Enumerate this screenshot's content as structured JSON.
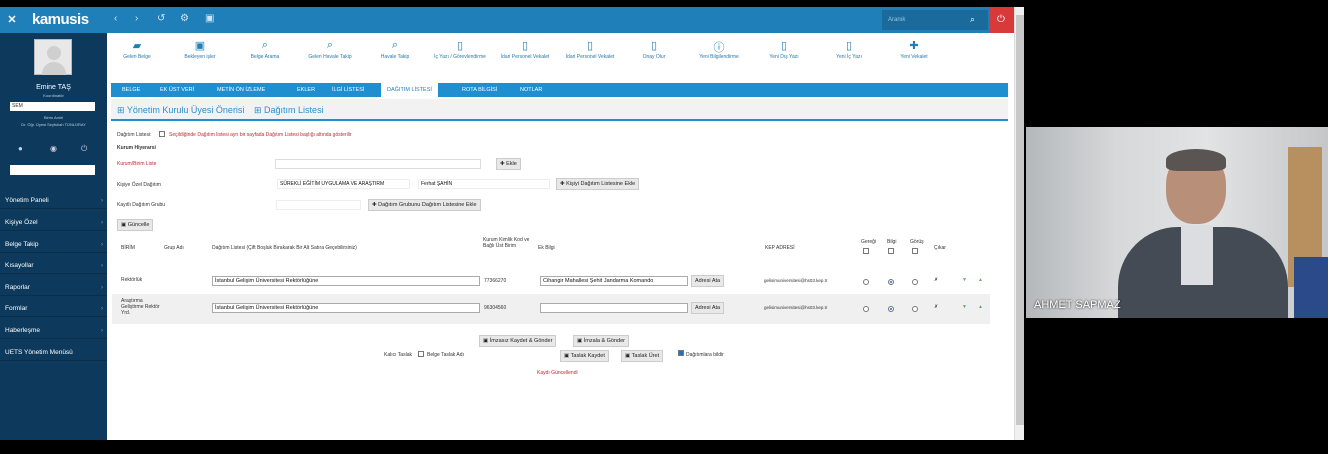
{
  "app": {
    "logo": "kamusis",
    "search_placeholder": "Aranık"
  },
  "sidebar": {
    "user_name": "Emine TAŞ",
    "user_role": "Koordinatör",
    "unit_select": "SEM",
    "info_line1": "Birim Amiri",
    "info_line2": "Dr. Öğr. Üyesi Seyfullah TÜNLÜRAY",
    "menu": [
      "Yönetim Paneli",
      "Kişiye Özel",
      "Belge Takip",
      "Kısayollar",
      "Raporlar",
      "Formlar",
      "Haberleşme",
      "UETS Yönetim Menüsü"
    ]
  },
  "toolbar": [
    "Gelen Belge",
    "Bekleyen işler",
    "Belge Arama",
    "Gelen Havale Takip",
    "Havale Takip",
    "İç Yazı / Görevlendirme",
    "İdari Personel Vekalet",
    "İdari Personel Vekalet",
    "Onay Olur",
    "Yeni Bilgilendirme",
    "Yeni Dış Yazı",
    "Yeni İç Yazı",
    "Yeni Vekalet"
  ],
  "tabs": [
    "BELGE",
    "EK ÜST VERİ",
    "METİN ÖN İZLEME",
    "EKLER",
    "İLGİ LİSTESİ",
    "DAĞITIM LİSTESİ",
    "ROTA BİLGİSİ",
    "NOTLAR"
  ],
  "breadcrumb": {
    "item1": "Yönetim Kurulu Üyesi Önerisi",
    "item2": "Dağıtım Listesi"
  },
  "form": {
    "dist_label": "Dağıtım Listesi:",
    "dist_note": "Seçildiğinde Dağıtım listesi ayrı bir sayfada Dağıtım Listesi başlığı altında gösterilir",
    "kurum_hiyerarsi": "Kurum Hiyerarsi",
    "kurum_birim_label": "Kurum/Birim Liste",
    "ekle": "Ekle",
    "kisiye_ozel_label": "Kişiye Özel Dağıtım",
    "kisiye_ozel_value": "SÜREKLİ EĞİTİM UYGULAMA VE ARAŞTIRM",
    "kisi_value": "Ferhat ŞAHİN",
    "kisiyi_ekle": "Kişiyi Dağıtım Listesine Ekle",
    "kayitli_label": "Kayıtlı Dağıtım Grubu",
    "grup_ekle": "Dağıtım Grubunu Dağıtım Listesine Ekle",
    "guncelle": "Güncelle"
  },
  "table": {
    "headers": {
      "birim": "BİRİM",
      "grup": "Grup Adı",
      "liste": "Dağıtım Listesi (Çift Boşluk Bırakarak Bir Alt Satıra Geçebilirsiniz)",
      "kurum_kod": "Kurum Kimlik Kod ve Bağlı Üst Birim",
      "ek": "Ek Bilgi",
      "kep": "KEP ADRESİ",
      "geregi": "Gereği",
      "bilgi": "Bilgi",
      "gorus": "Görüş",
      "cikar": "Çıkar"
    },
    "rows": [
      {
        "birim": "Rektörlük",
        "liste": "İstanbul Gelişim Üniversitesi Rektörlüğüne",
        "kod": "77366270",
        "ek": "Cihangir Mahallesi Şehit Jandarma Komando",
        "adres_btn": "Adresi Ata",
        "kep": "gelisimuniversitesi@hs03.kep.tr"
      },
      {
        "birim": "Araştırma Geliştirme Rektör Yrd.",
        "liste": "İstanbul Gelişim Üniversitesi Rektörlüğüne",
        "kod": "96304560",
        "ek": "",
        "adres_btn": "Adresi Ata",
        "kep": "gelisimuniversitesi@hs03.kep.tr"
      }
    ]
  },
  "actions": {
    "imzasiz": "İmzasız Kaydet & Gönder",
    "imzala": "İmzala & Gönder",
    "kalici_taslak": "Kalıcı Taslak",
    "taslak_adi": "Belge Taslak Adı",
    "taslak_kaydet": "Taslak Kaydet",
    "taslak_uret": "Taslak Üret",
    "dagitimlara_bildir": "Dağıtımlara bildir",
    "kaydi_guncellendi": "Kaydı Güncellendi"
  },
  "video": {
    "participant": "AHMET SAPMAZ"
  }
}
